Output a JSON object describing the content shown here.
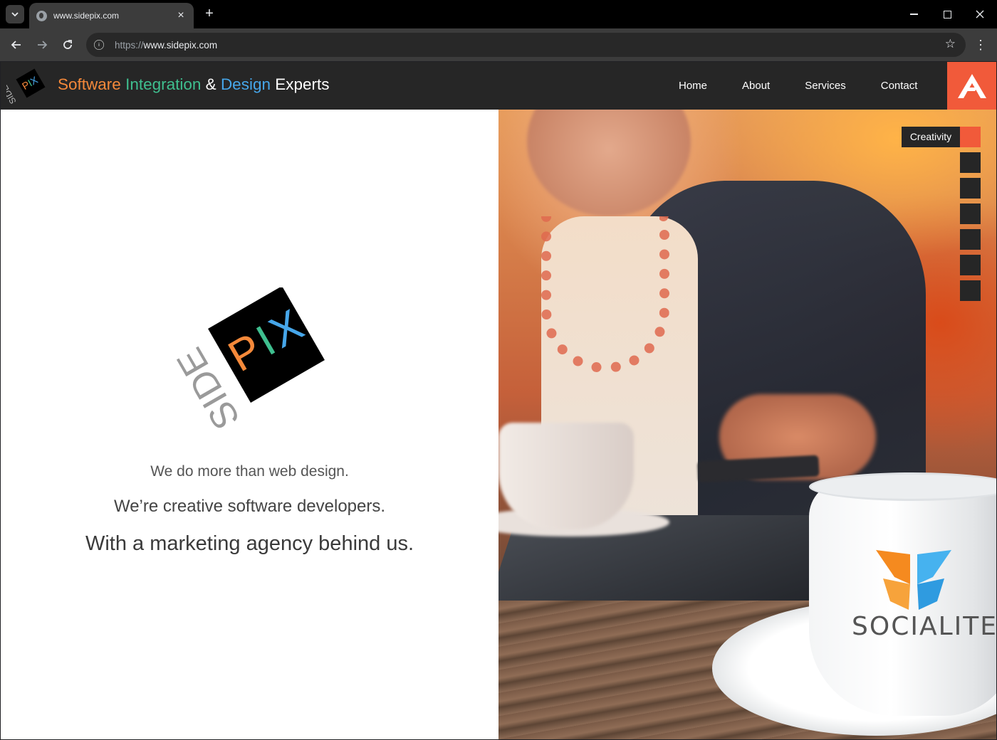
{
  "browser": {
    "tab_title": "www.sidepix.com",
    "new_tab_symbol": "+",
    "url_scheme": "https://",
    "url_host": "www.sidepix.com"
  },
  "header": {
    "logo_side": "SIDE",
    "logo_pix": "PIX",
    "tagline": {
      "part1": "Software",
      "part2": "Integration",
      "part3": "&",
      "part4": "Design",
      "part5": "Experts"
    },
    "nav": [
      {
        "label": "Home"
      },
      {
        "label": "About"
      },
      {
        "label": "Services"
      },
      {
        "label": "Contact"
      }
    ],
    "brand_color": "#f15a3a"
  },
  "intro": {
    "logo_side": "SIDE",
    "logo_pix": "PIX",
    "line1": "We do more than web design.",
    "line2": "We’re creative software developers.",
    "line3": "With a marketing agency behind us."
  },
  "hero": {
    "slide_label": "Creativity",
    "slide_count": 7,
    "active_slide": 1,
    "cup_brand": "SOCIALITE"
  },
  "colors": {
    "header_bg": "#262626",
    "orange": "#f5893a",
    "green": "#3fbf8f",
    "blue": "#46a6e9",
    "accent": "#f15a3a"
  }
}
